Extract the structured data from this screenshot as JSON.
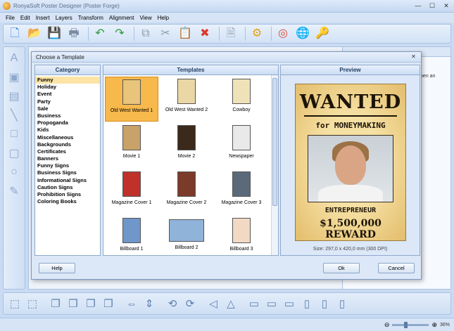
{
  "app": {
    "title": "RonyaSoft Poster Designer (Poster Forge)",
    "min": "—",
    "max": "☐",
    "close": "✕"
  },
  "menu": [
    "File",
    "Edit",
    "Insert",
    "Layers",
    "Transform",
    "Alignment",
    "View",
    "Help"
  ],
  "toolbar_icons": [
    {
      "name": "new-icon",
      "glyph": "🗋",
      "color": "#2f7fd4"
    },
    {
      "name": "open-icon",
      "glyph": "📂",
      "color": "#e3a21a"
    },
    {
      "name": "save-icon",
      "glyph": "💾",
      "color": "#7a8aa0"
    },
    {
      "name": "print-icon",
      "glyph": "🖶",
      "color": "#7a8aa0"
    },
    {
      "name": "undo-icon",
      "glyph": "↶",
      "color": "#2a9a3a"
    },
    {
      "name": "redo-icon",
      "glyph": "↷",
      "color": "#2a9a3a"
    },
    {
      "name": "copy-icon",
      "glyph": "⧉",
      "color": "#8c9bb0"
    },
    {
      "name": "cut-icon",
      "glyph": "✂",
      "color": "#8c9bb0"
    },
    {
      "name": "paste-icon",
      "glyph": "📋",
      "color": "#8c9bb0"
    },
    {
      "name": "delete-icon",
      "glyph": "✖",
      "color": "#d93a2a"
    },
    {
      "name": "properties-icon",
      "glyph": "🗎",
      "color": "#8c9bb0"
    },
    {
      "name": "settings-icon",
      "glyph": "⚙",
      "color": "#e3a21a"
    },
    {
      "name": "help-lifebuoy-icon",
      "glyph": "◎",
      "color": "#e0492e"
    },
    {
      "name": "web-globe-icon",
      "glyph": "🌐",
      "color": "#2a8fd0"
    },
    {
      "name": "key-icon",
      "glyph": "🔑",
      "color": "#d9a21a"
    }
  ],
  "left_tools": [
    {
      "name": "text-tool-icon",
      "glyph": "A"
    },
    {
      "name": "image-tool-icon",
      "glyph": "▣"
    },
    {
      "name": "image-frame-tool-icon",
      "glyph": "▤"
    },
    {
      "name": "line-tool-icon",
      "glyph": "╲"
    },
    {
      "name": "rectangle-tool-icon",
      "glyph": "□"
    },
    {
      "name": "rounded-rect-tool-icon",
      "glyph": "▢"
    },
    {
      "name": "ellipse-tool-icon",
      "glyph": "○"
    },
    {
      "name": "pencil-tool-icon",
      "glyph": "✎"
    }
  ],
  "right_panel": {
    "text": "pen an"
  },
  "bottom_tools": [
    {
      "name": "group-icon",
      "glyph": "⬚"
    },
    {
      "name": "ungroup-icon",
      "glyph": "⬚"
    },
    {
      "name": "bring-front-icon",
      "glyph": "❐"
    },
    {
      "name": "send-back-icon",
      "glyph": "❐"
    },
    {
      "name": "bring-forward-icon",
      "glyph": "❐"
    },
    {
      "name": "send-backward-icon",
      "glyph": "❐"
    },
    {
      "name": "flip-horizontal-icon",
      "glyph": "⇔"
    },
    {
      "name": "flip-vertical-icon",
      "glyph": "⇕"
    },
    {
      "name": "rotate-left-icon",
      "glyph": "⟲"
    },
    {
      "name": "rotate-right-icon",
      "glyph": "⟳"
    },
    {
      "name": "skew-left-icon",
      "glyph": "◁"
    },
    {
      "name": "skew-right-icon",
      "glyph": "△"
    },
    {
      "name": "align-left-icon",
      "glyph": "▭"
    },
    {
      "name": "align-center-icon",
      "glyph": "▭"
    },
    {
      "name": "align-right-icon",
      "glyph": "▭"
    },
    {
      "name": "align-top-icon",
      "glyph": "▯"
    },
    {
      "name": "align-middle-icon",
      "glyph": "▯"
    },
    {
      "name": "align-bottom-icon",
      "glyph": "▯"
    }
  ],
  "status": {
    "zoom": "36%",
    "zoom_fraction": 0.36
  },
  "dialog": {
    "title": "Choose a Template",
    "close": "✕",
    "category_header": "Category",
    "templates_header": "Templates",
    "preview_header": "Preview",
    "categories": [
      "Funny",
      "Holiday",
      "Event",
      "Party",
      "Sale",
      "Business",
      "Propoganda",
      "Kids",
      "Miscellaneous",
      "Backgrounds",
      "Certificates",
      "Banners",
      "Funny Signs",
      "Business Signs",
      "Informational Signs",
      "Caution Signs",
      "Prohibition Signs",
      "Coloring Books"
    ],
    "selected_category": "Funny",
    "templates": [
      {
        "label": "Old West Wanted 1",
        "color": "#e8c57a",
        "selected": true,
        "wide": false
      },
      {
        "label": "Old West Wanted 2",
        "color": "#ead7a6",
        "selected": false,
        "wide": false
      },
      {
        "label": "Cowboy",
        "color": "#f0e2b8",
        "selected": false,
        "wide": false
      },
      {
        "label": "Movie 1",
        "color": "#c9a26a",
        "selected": false,
        "wide": false
      },
      {
        "label": "Movie 2",
        "color": "#3b2a1c",
        "selected": false,
        "wide": false
      },
      {
        "label": "Newspaper",
        "color": "#e9e9e9",
        "selected": false,
        "wide": false
      },
      {
        "label": "Magazine Cover 1",
        "color": "#c0312a",
        "selected": false,
        "wide": false
      },
      {
        "label": "Magazine Cover 2",
        "color": "#7b3b2a",
        "selected": false,
        "wide": false
      },
      {
        "label": "Magazine Cover 3",
        "color": "#5a6a7a",
        "selected": false,
        "wide": false
      },
      {
        "label": "Billboard 1",
        "color": "#6f97c9",
        "selected": false,
        "wide": false
      },
      {
        "label": "Billboard 2",
        "color": "#8fb3d9",
        "selected": false,
        "wide": true
      },
      {
        "label": "Billboard 3",
        "color": "#f1d9c4",
        "selected": false,
        "wide": false
      }
    ],
    "poster": {
      "headline": "WANTED",
      "subline": "for MONEYMAKING",
      "role": "ENTREPRENEUR",
      "reward": "$1,500,000 REWARD"
    },
    "size_text": "Size: 297,0 x 420,0 mm (300 DPI)",
    "buttons": {
      "help": "Help",
      "ok": "Ok",
      "cancel": "Cancel"
    }
  }
}
